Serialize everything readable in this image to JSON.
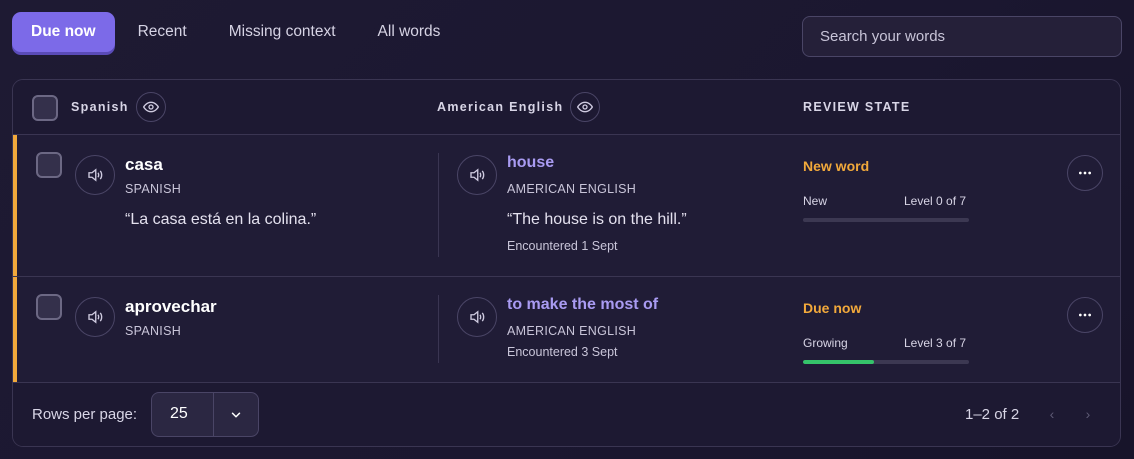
{
  "tabs": [
    {
      "label": "Due now",
      "active": true
    },
    {
      "label": "Recent",
      "active": false
    },
    {
      "label": "Missing context",
      "active": false
    },
    {
      "label": "All words",
      "active": false
    }
  ],
  "search": {
    "placeholder": "Search your words"
  },
  "table": {
    "headers": {
      "source": "Spanish",
      "target": "American English",
      "review": "REVIEW STATE"
    },
    "rows": [
      {
        "word": "casa",
        "source_lang": "SPANISH",
        "example": "“La casa está en la colina.”",
        "translation": "house",
        "target_lang": "AMERICAN ENGLISH",
        "translation_example": "“The house is on the hill.”",
        "encountered": "Encountered 1 Sept",
        "state": "New word",
        "stage": "New",
        "level": "Level 0 of 7",
        "progress": 0
      },
      {
        "word": "aprovechar",
        "source_lang": "SPANISH",
        "translation": "to make the most of",
        "target_lang": "AMERICAN ENGLISH",
        "encountered": "Encountered 3 Sept",
        "state": "Due now",
        "stage": "Growing",
        "level": "Level 3 of 7",
        "progress": 0.43
      }
    ]
  },
  "footer": {
    "rows_per_page_label": "Rows per page:",
    "rows_per_page_value": "25",
    "range": "1–2 of 2",
    "prev_glyph": "‹",
    "next_glyph": "›"
  },
  "colors": {
    "accent": "#7c6ae8",
    "due": "#f2a93b",
    "translation": "#a99bf2",
    "progress": "#35c36a"
  }
}
